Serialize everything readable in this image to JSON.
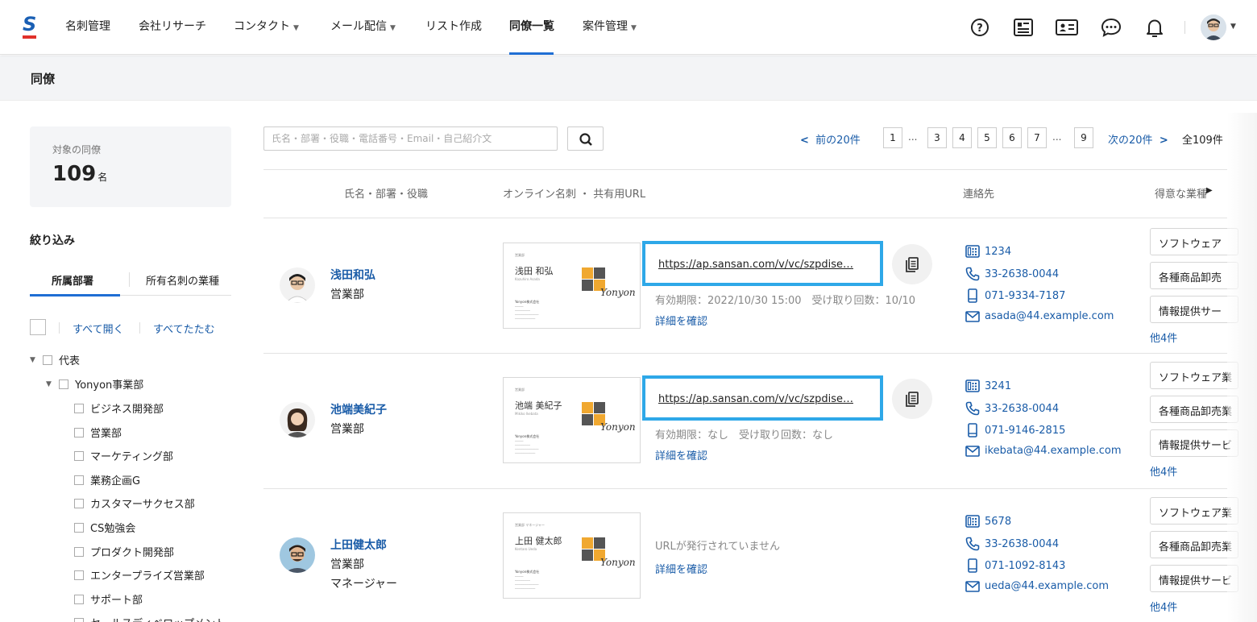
{
  "nav": {
    "logo": "S",
    "items": [
      {
        "label": "名刺管理",
        "dropdown": false,
        "active": false
      },
      {
        "label": "会社リサーチ",
        "dropdown": false,
        "active": false
      },
      {
        "label": "コンタクト",
        "dropdown": true,
        "active": false
      },
      {
        "label": "メール配信",
        "dropdown": true,
        "active": false
      },
      {
        "label": "リスト作成",
        "dropdown": false,
        "active": false
      },
      {
        "label": "同僚一覧",
        "dropdown": false,
        "active": true
      },
      {
        "label": "案件管理",
        "dropdown": true,
        "active": false
      }
    ],
    "icons": [
      "help-icon",
      "card-list-icon",
      "id-card-icon",
      "chat-icon",
      "bell-icon"
    ]
  },
  "page": {
    "title": "同僚"
  },
  "summary": {
    "label": "対象の同僚",
    "count": "109",
    "unit": "名"
  },
  "filter": {
    "title": "絞り込み",
    "tabs": [
      "所属部署",
      "所有名刺の業種"
    ],
    "expand_all": "すべて開く",
    "collapse_all": "すべてたたむ",
    "tree": [
      {
        "label": "代表",
        "level": 0,
        "expandable": true
      },
      {
        "label": "Yonyon事業部",
        "level": 1,
        "expandable": true
      },
      {
        "label": "ビジネス開発部",
        "level": 2,
        "expandable": false
      },
      {
        "label": "営業部",
        "level": 2,
        "expandable": false
      },
      {
        "label": "マーケティング部",
        "level": 2,
        "expandable": false
      },
      {
        "label": "業務企画G",
        "level": 2,
        "expandable": false
      },
      {
        "label": "カスタマーサクセス部",
        "level": 2,
        "expandable": false
      },
      {
        "label": "CS勉強会",
        "level": 2,
        "expandable": false
      },
      {
        "label": "プロダクト開発部",
        "level": 2,
        "expandable": false
      },
      {
        "label": "エンタープライズ営業部",
        "level": 2,
        "expandable": false
      },
      {
        "label": "サポート部",
        "level": 2,
        "expandable": false
      },
      {
        "label": "セールスディベロップメント",
        "level": 2,
        "expandable": false
      }
    ]
  },
  "search": {
    "placeholder": "氏名・部署・役職・電話番号・Email・自己紹介文",
    "value": ""
  },
  "pager": {
    "prev": "前の20件",
    "next": "次の20件",
    "total": "全109件",
    "pages": [
      "1",
      "3",
      "4",
      "5",
      "6",
      "7",
      "9"
    ],
    "ellipsis": "..."
  },
  "table": {
    "headers": {
      "name": "氏名・部署・役職",
      "card": "オンライン名刺 ・ 共有用URL",
      "contact": "連絡先",
      "industry": "得意な業種"
    },
    "detail_label": "詳細を確認",
    "more_label": "他4件",
    "no_url": "URLが発行されていません",
    "rows": [
      {
        "name": "浅田和弘",
        "dept": "営業部",
        "title": "",
        "card": {
          "name": "浅田 和弘",
          "roman": "Kazuhiro Asada",
          "title": "営業部",
          "company": "Yonyon株式会社",
          "brand": "Yonyon"
        },
        "url": "https://ap.sansan.com/v/vc/szpdise…",
        "meta": "有効期限：2022/10/30 15:00　受け取り回数：10/10",
        "ext": "1234",
        "phone": "33-2638-0044",
        "mobile": "071-9334-7187",
        "email": "asada@44.example.com",
        "tags": [
          "ソフトウェア",
          "各種商品卸売",
          "情報提供サー"
        ]
      },
      {
        "name": "池端美紀子",
        "dept": "営業部",
        "title": "",
        "card": {
          "name": "池端 美紀子",
          "roman": "Mikiko Ikebata",
          "title": "営業部",
          "company": "Yonyon株式会社",
          "brand": "Yonyon"
        },
        "url": "https://ap.sansan.com/v/vc/szpdise…",
        "meta": "有効期限：なし　受け取り回数：なし",
        "ext": "3241",
        "phone": "33-2638-0044",
        "mobile": "071-9146-2815",
        "email": "ikebata@44.example.com",
        "tags": [
          "ソフトウェア業",
          "各種商品卸売業",
          "情報提供サービ"
        ]
      },
      {
        "name": "上田健太郎",
        "dept": "営業部",
        "title": "マネージャー",
        "card": {
          "name": "上田 健太郎",
          "roman": "Kentaro Ueda",
          "title": "営業部 マネージャー",
          "company": "Yonyon株式会社",
          "brand": "Yonyon"
        },
        "url": "",
        "meta": "",
        "ext": "5678",
        "phone": "33-2638-0044",
        "mobile": "071-1092-8143",
        "email": "ueda@44.example.com",
        "tags": [
          "ソフトウェア業",
          "各種商品卸売業",
          "情報提供サービ"
        ]
      }
    ]
  },
  "colors": {
    "accent": "#1f6ed4",
    "link": "#1a5ca8",
    "highlight": "#2ea8e8",
    "brand_orange": "#f0a830",
    "brand_gray": "#555555"
  }
}
